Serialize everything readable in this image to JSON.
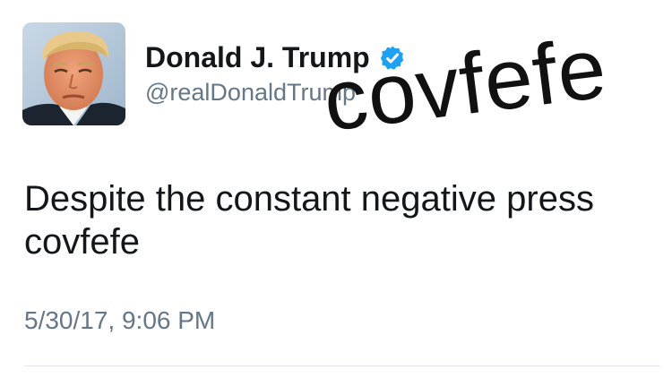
{
  "user": {
    "display_name": "Donald J. Trump",
    "handle": "@realDonaldTrump",
    "verified": true,
    "avatar_icon": "profile-photo"
  },
  "overlay": {
    "word": "covfefe"
  },
  "tweet": {
    "text_lines": [
      "Despite the constant negative press",
      "covfefe"
    ],
    "timestamp": "5/30/17, 9:06 PM"
  },
  "colors": {
    "verified_badge": "#1da1f2",
    "secondary_text": "#657786",
    "primary_text": "#14171a"
  }
}
